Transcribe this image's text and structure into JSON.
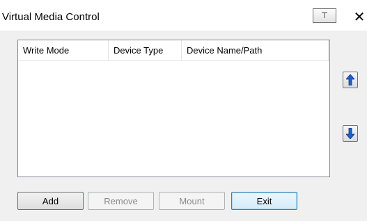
{
  "window": {
    "title": "Virtual Media Control",
    "pin_label": "⊤",
    "close_label": "✕"
  },
  "table": {
    "columns": [
      "Write Mode",
      "Device Type",
      "Device Name/Path"
    ],
    "rows": []
  },
  "controls": {
    "move_up_icon": "arrow-up-icon",
    "move_down_icon": "arrow-down-icon",
    "arrow_color": "#1a5fd6"
  },
  "buttons": {
    "add": "Add",
    "remove": "Remove",
    "mount": "Mount",
    "exit": "Exit"
  }
}
